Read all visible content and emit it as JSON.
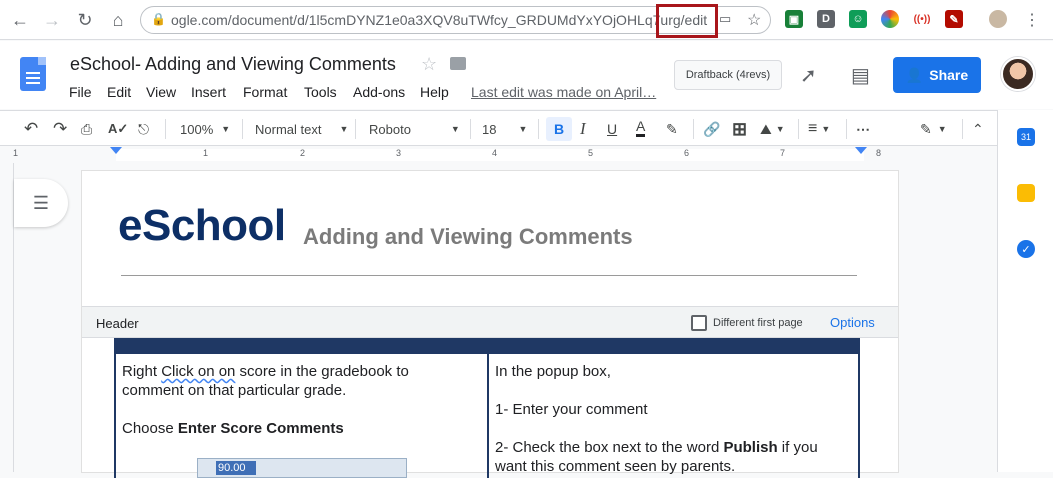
{
  "browser": {
    "url": "ogle.com/document/d/1l5cmDYNZ1e0a3XQV8uTWfcy_GRDUMdYxYOjOHLq7urg/edit",
    "extensions": [
      "google-classroom-icon",
      "d-extension-icon",
      "gradebook-icon",
      "color-wheel-icon",
      "cast-icon",
      "pdf-icon",
      "unknown-icon",
      "profile-icon"
    ]
  },
  "doc": {
    "title": "eSchool- Adding and Viewing Comments",
    "menu": [
      "File",
      "Edit",
      "View",
      "Insert",
      "Format",
      "Tools",
      "Add-ons",
      "Help"
    ],
    "last_edit": "Last edit was made on April…",
    "draftback": "Draftback (4revs)",
    "share": "Share"
  },
  "toolbar": {
    "zoom": "100%",
    "style": "Normal text",
    "font": "Roboto",
    "size": "18"
  },
  "ruler": {
    "numbers": [
      "1",
      "1",
      "2",
      "3",
      "4",
      "5",
      "6",
      "7",
      "8"
    ]
  },
  "page": {
    "title": "eSchool",
    "subtitle": "Adding and Viewing Comments"
  },
  "header_bar": {
    "label": "Header",
    "different_first_page": "Different first page",
    "options": "Options"
  },
  "table": {
    "left": {
      "line1_a": "Right ",
      "line1_squiggle": "Click on on",
      "line1_b": " score in the gradebook to",
      "line2": "comment on that particular grade.",
      "line3_a": "Choose ",
      "line3_b": "Enter Score Comments",
      "thumb_value": "90.00"
    },
    "right": {
      "line1": "In the popup box,",
      "line2": "1- Enter your comment",
      "line3_a": "2- Check the box next to the word ",
      "line3_b": "Publish",
      "line3_c": " if you",
      "line4": "want this comment seen by parents."
    }
  },
  "colors": {
    "accent": "#1a73e8",
    "title_navy": "#0d2f66",
    "table_border": "#1f3864",
    "highlight_box": "#a8161b"
  }
}
